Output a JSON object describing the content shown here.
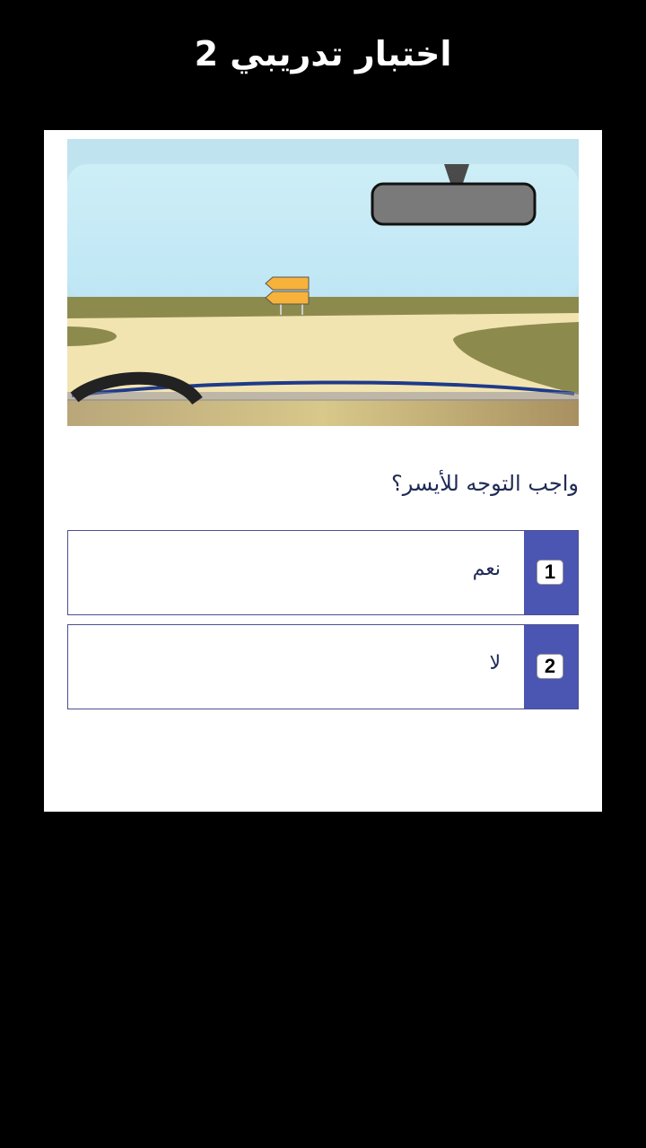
{
  "header": {
    "title": "اختبار تدريبي 2"
  },
  "scene": {
    "image": "driver-view-road-with-left-direction-sign"
  },
  "question": {
    "text": "واجب التوجه للأيسر؟"
  },
  "answers": [
    {
      "number": "1",
      "label": "نعم"
    },
    {
      "number": "2",
      "label": "لا"
    }
  ],
  "colors": {
    "background": "#000000",
    "card": "#ffffff",
    "accent": "#4b55b2",
    "text": "#1f2a55"
  }
}
